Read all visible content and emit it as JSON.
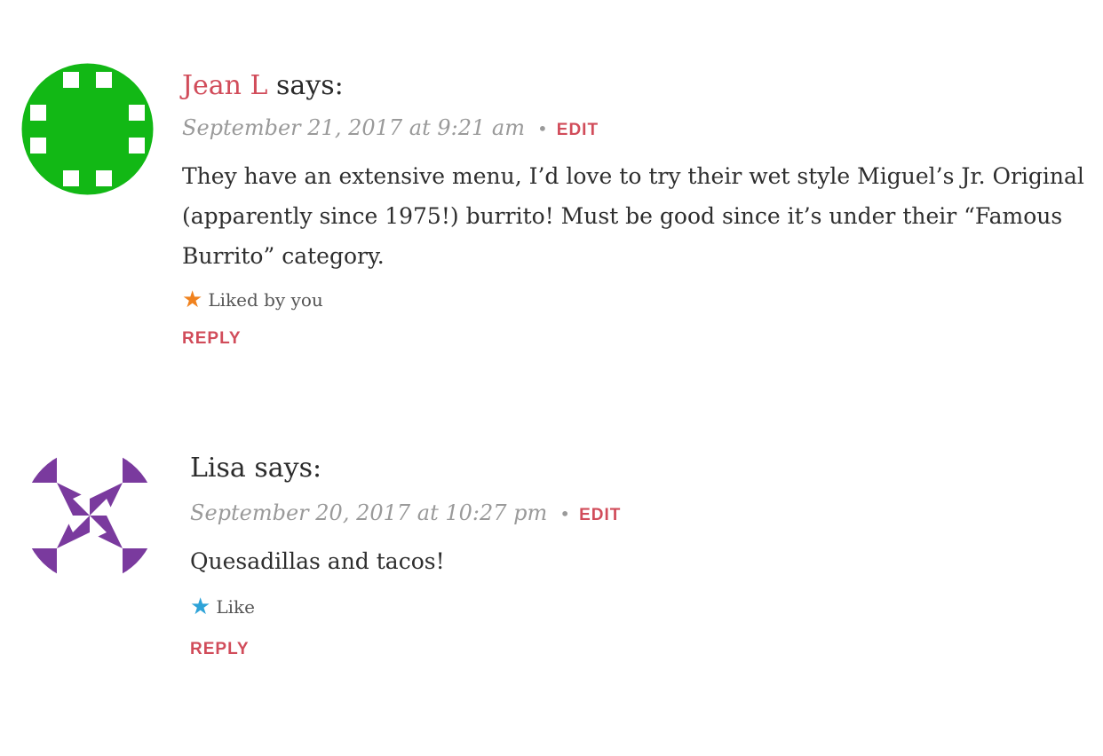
{
  "colors": {
    "accent": "#d14c5a",
    "meta_gray": "#9a9a9a",
    "text": "#2e2e2e",
    "liked_star": "#f0821e",
    "like_star": "#2ea3d8",
    "avatar_green": "#12b815",
    "avatar_purple": "#7a3a9e"
  },
  "comments": [
    {
      "author": "Jean L",
      "says": " says:",
      "date": "September 21, 2017 at 9:21 am",
      "separator": "•",
      "edit_label": "EDIT",
      "text": "They have an extensive menu, I’d love to try their wet style Miguel’s Jr. Original (apparently since 1975!) burrito! Must be good since it’s under their “Famous Burrito” category.",
      "like_icon": "star-icon",
      "like_label": "Liked by you",
      "reply_label": "REPLY"
    },
    {
      "author": "Lisa",
      "says": " says:",
      "date": "September 20, 2017 at 10:27 pm",
      "separator": "•",
      "edit_label": "EDIT",
      "text": "Quesadillas and tacos!",
      "like_icon": "star-icon",
      "like_label": "Like",
      "reply_label": "REPLY"
    }
  ]
}
